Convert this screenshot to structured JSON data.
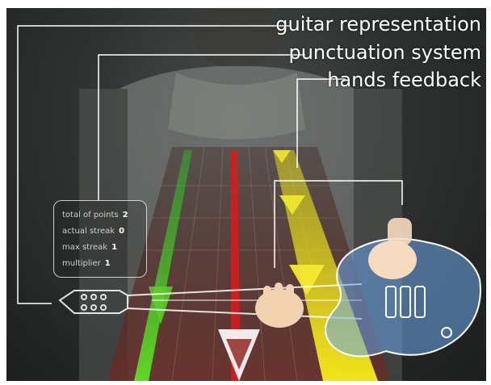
{
  "annotations": {
    "guitar_representation": "guitar representation",
    "punctuation_system": "punctuation system",
    "hands_feedback": "hands feedback"
  },
  "score_panel": {
    "rows": [
      {
        "label": "total of points",
        "value": "2"
      },
      {
        "label": "actual streak",
        "value": "0"
      },
      {
        "label": "max streak",
        "value": "1"
      },
      {
        "label": "multiplier",
        "value": "1"
      }
    ]
  },
  "colors": {
    "lane_green": "#2fb42c",
    "lane_red": "#d21e1e",
    "lane_yellow": "#f2ea18",
    "callout_line": "#ffffff",
    "fretboard": "#5a2a24"
  },
  "icons": [
    "arrow-marker-icon",
    "guitar-icon",
    "hand-icon"
  ]
}
